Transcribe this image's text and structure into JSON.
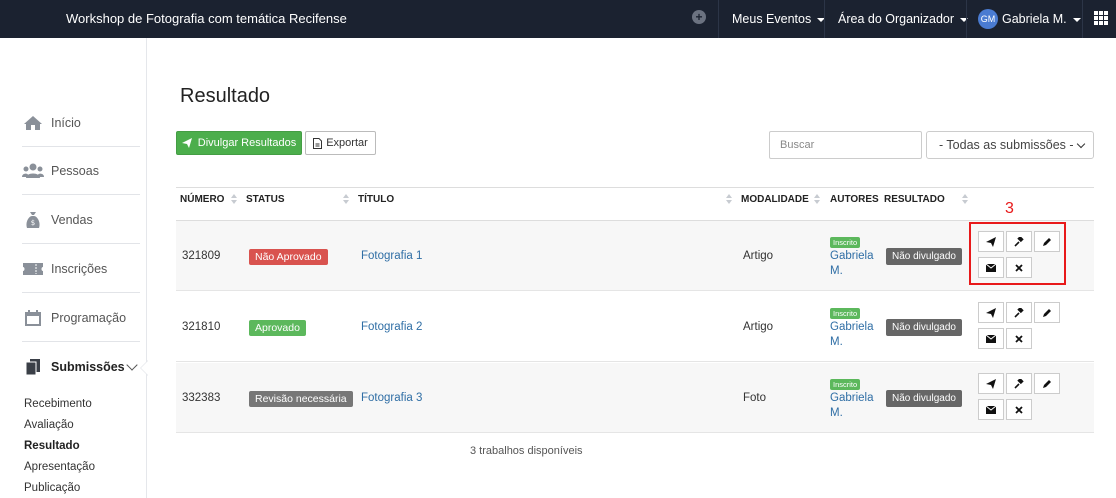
{
  "topbar": {
    "title": "Workshop de Fotografia com temática Recifense",
    "meus_eventos": "Meus Eventos",
    "area_organizador": "Área do Organizador",
    "avatar_initials": "GM",
    "user_name": "Gabriela M.",
    "bg_color": "#1b2230"
  },
  "sidebar": {
    "items": [
      {
        "label": "Início",
        "icon": "home-icon"
      },
      {
        "label": "Pessoas",
        "icon": "users-icon"
      },
      {
        "label": "Vendas",
        "icon": "money-bag-icon"
      },
      {
        "label": "Inscrições",
        "icon": "ticket-icon"
      },
      {
        "label": "Programação",
        "icon": "calendar-icon"
      },
      {
        "label": "Submissões",
        "icon": "documents-icon"
      }
    ],
    "sub_items": [
      "Recebimento",
      "Avaliação",
      "Resultado",
      "Apresentação",
      "Publicação"
    ],
    "current_sub": "Resultado"
  },
  "main": {
    "title": "Resultado",
    "divulgar_label": "Divulgar Resultados",
    "exportar_label": "Exportar",
    "search_placeholder": "Buscar",
    "filter_value": "- Todas as submissões -"
  },
  "table": {
    "headers": [
      "NÚMERO",
      "STATUS",
      "TÍTULO",
      "MODALIDADE",
      "AUTORES",
      "RESULTADO"
    ],
    "rows": [
      {
        "numero": "321809",
        "status": "Não Aprovado",
        "status_color": "#d9534f",
        "titulo": "Fotografia 1",
        "modalidade": "Artigo",
        "tag": "Inscrito",
        "autor_1": "Gabriela",
        "autor_2": "M.",
        "resultado": "Não divulgado"
      },
      {
        "numero": "321810",
        "status": "Aprovado",
        "status_color": "#5cb85c",
        "titulo": "Fotografia 2",
        "modalidade": "Artigo",
        "tag": "Inscrito",
        "autor_1": "Gabriela",
        "autor_2": "M.",
        "resultado": "Não divulgado"
      },
      {
        "numero": "332383",
        "status": "Revisão necessária",
        "status_color": "#777777",
        "titulo": "Fotografia 3",
        "modalidade": "Foto",
        "tag": "Inscrito",
        "autor_1": "Gabriela",
        "autor_2": "M.",
        "resultado": "Não divulgado"
      }
    ],
    "footer": "3 trabalhos disponíveis"
  },
  "annotation": {
    "label": "3",
    "color": "#e8191a"
  }
}
